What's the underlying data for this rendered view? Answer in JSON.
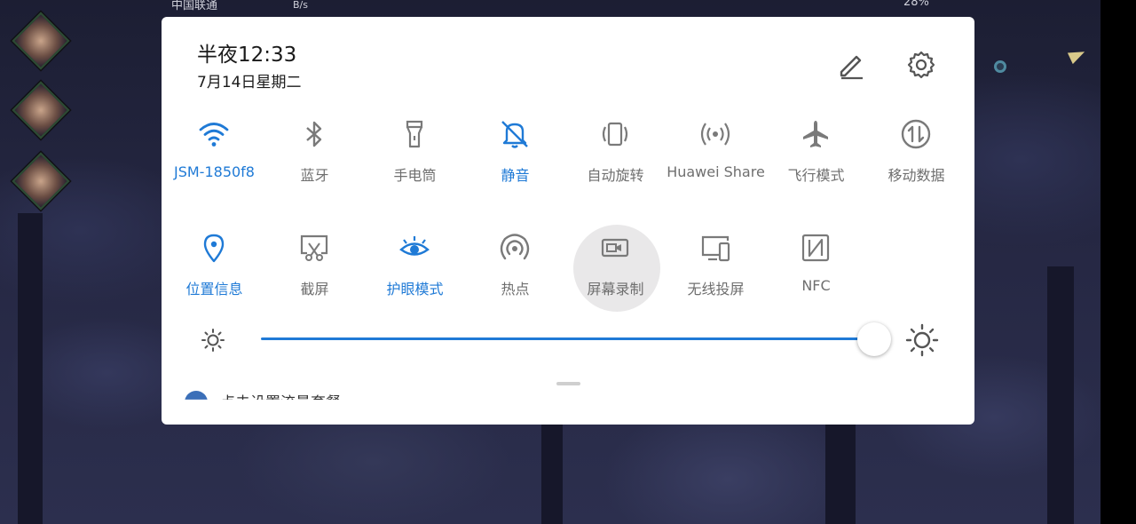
{
  "status_bar": {
    "carrier": "中国联通",
    "speed": "B/s",
    "battery": "28%"
  },
  "panel": {
    "time": "半夜12:33",
    "date": "7月14日星期二",
    "edit_icon": "pencil-icon",
    "settings_icon": "gear-icon"
  },
  "tiles_row1": [
    {
      "label": "JSM-1850f8",
      "icon": "wifi-icon",
      "active": true
    },
    {
      "label": "蓝牙",
      "icon": "bluetooth-icon",
      "active": false
    },
    {
      "label": "手电筒",
      "icon": "flashlight-icon",
      "active": false
    },
    {
      "label": "静音",
      "icon": "bell-off-icon",
      "active": true
    },
    {
      "label": "自动旋转",
      "icon": "auto-rotate-icon",
      "active": false
    },
    {
      "label": "Huawei Share",
      "icon": "huawei-share-icon",
      "active": false
    },
    {
      "label": "飞行模式",
      "icon": "airplane-icon",
      "active": false
    },
    {
      "label": "移动数据",
      "icon": "mobile-data-icon",
      "active": false
    }
  ],
  "tiles_row2": [
    {
      "label": "位置信息",
      "icon": "location-pin-icon",
      "active": true
    },
    {
      "label": "截屏",
      "icon": "screenshot-icon",
      "active": false
    },
    {
      "label": "护眼模式",
      "icon": "eye-comfort-icon",
      "active": true
    },
    {
      "label": "热点",
      "icon": "hotspot-icon",
      "active": false
    },
    {
      "label": "屏幕录制",
      "icon": "screen-record-icon",
      "active": false
    },
    {
      "label": "无线投屏",
      "icon": "wireless-projection-icon",
      "active": false
    },
    {
      "label": "NFC",
      "icon": "nfc-icon",
      "active": false
    }
  ],
  "brightness": {
    "level": 1.0,
    "min_icon": "sun-small-icon",
    "max_icon": "sun-large-icon"
  },
  "underlying_notification": {
    "text": "点击设置流量套餐"
  },
  "colors": {
    "accent": "#1f7ad6",
    "inactive": "#6f6f6f",
    "panel_bg": "#ffffff"
  }
}
